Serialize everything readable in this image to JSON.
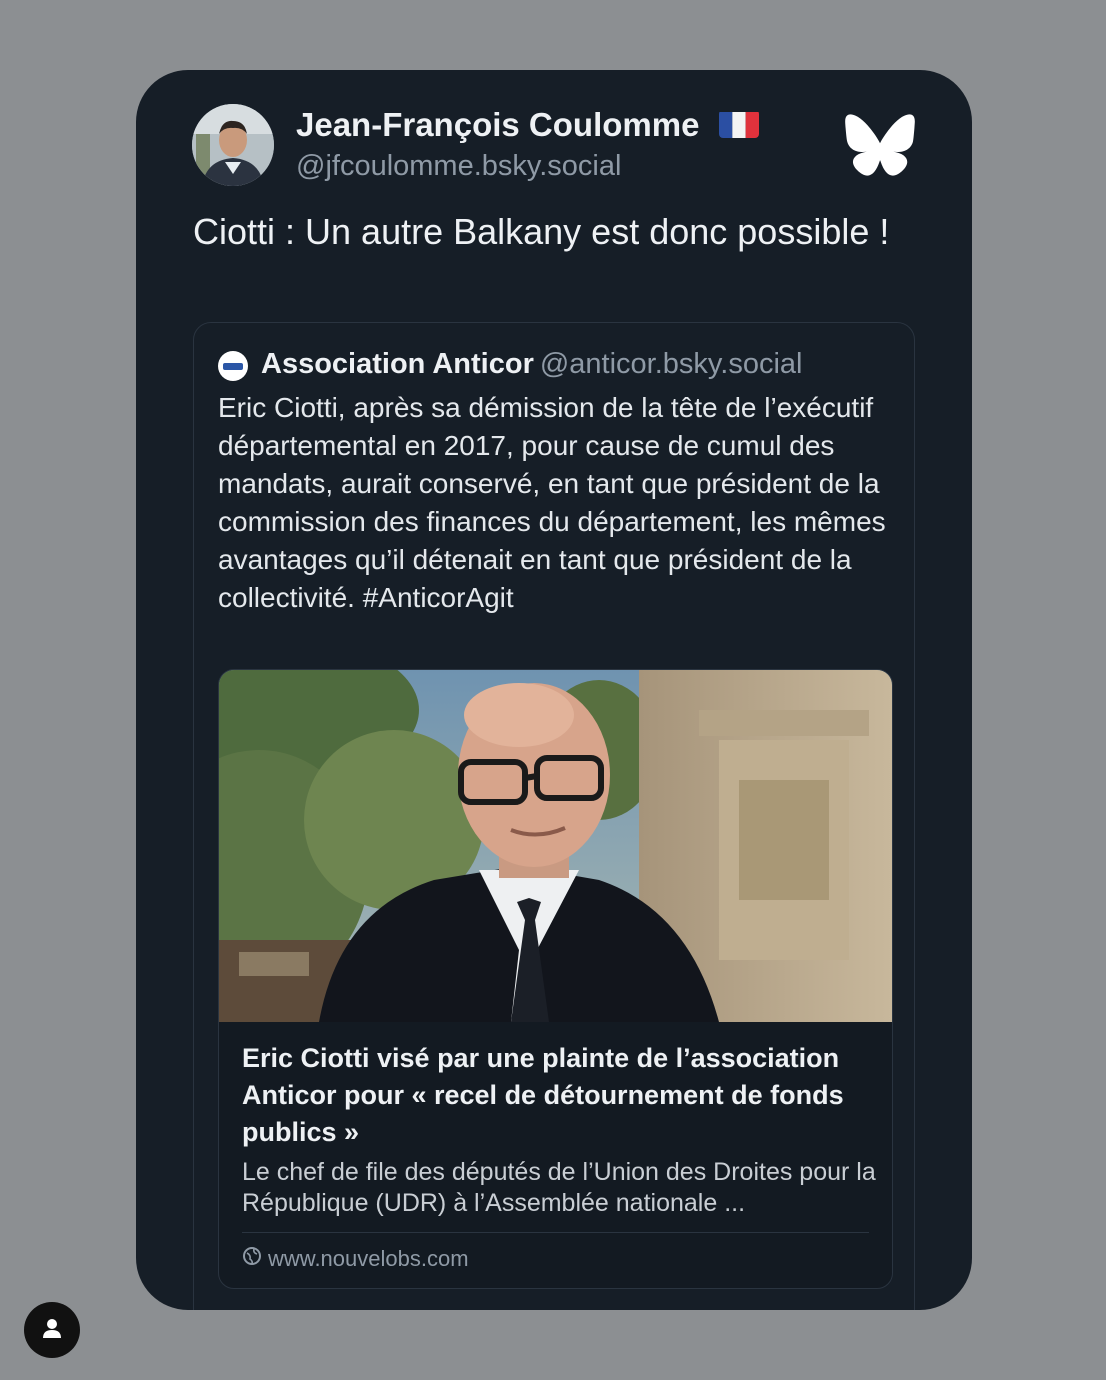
{
  "post": {
    "author_name": "Jean-François Coulomme",
    "author_handle": "@jfcoulomme.bsky.social",
    "text": "Ciotti : Un autre Balkany est donc possible !"
  },
  "icons": {
    "flag": "france-flag-icon",
    "platform_logo": "bluesky-butterfly-icon",
    "globe": "globe-icon",
    "profile": "user-icon"
  },
  "quote": {
    "author_name": "Association Anticor",
    "author_handle": "@anticor.bsky.social",
    "text": "Eric Ciotti, après sa démission de la tête de l’exécutif départemental en 2017, pour cause de cumul des mandats, aurait conservé, en tant que président de la commission des finances du département, les mêmes avantages qu’il détenait en tant que président de la collectivité. #AnticorAgit",
    "link": {
      "title": "Eric Ciotti visé par une plainte de l’association Anticor pour « recel de détournement de fonds publics »",
      "description": "Le chef de file des députés de l’Union des Droites pour la République (UDR) à l’Assemblée nationale ...",
      "domain": "www.nouvelobs.com"
    }
  },
  "colors": {
    "background": "#8c8f92",
    "card": "#161e27",
    "text_primary": "#eef1f4",
    "text_secondary": "#8f9aa6"
  }
}
